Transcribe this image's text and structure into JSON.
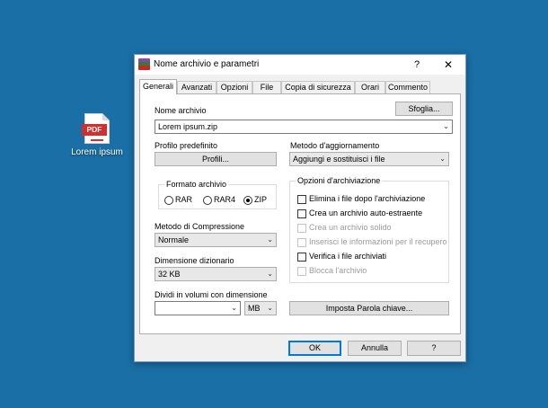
{
  "desktop": {
    "icon_label": "Lorem ipsum",
    "icon_badge": "PDF"
  },
  "dialog": {
    "title": "Nome archivio e parametri",
    "help_glyph": "?",
    "close_glyph": "✕",
    "tabs": [
      "Generali",
      "Avanzati",
      "Opzioni",
      "File",
      "Copia di sicurezza",
      "Orari",
      "Commento"
    ],
    "active_tab": "Generali",
    "archive_name_label": "Nome archivio",
    "browse_button": "Sfoglia...",
    "archive_name_value": "Lorem ipsum.zip",
    "default_profile_label": "Profilo predefinito",
    "profiles_button": "Profili...",
    "update_method_label": "Metodo d'aggiornamento",
    "update_method_value": "Aggiungi e sostituisci i file",
    "archive_format_label": "Formato archivio",
    "formats": [
      "RAR",
      "RAR4",
      "ZIP"
    ],
    "selected_format": "ZIP",
    "compression_label": "Metodo di Compressione",
    "compression_value": "Normale",
    "dictionary_label": "Dimensione dizionario",
    "dictionary_value": "32 KB",
    "split_label": "Dividi in volumi con dimensione",
    "split_value": "",
    "split_unit": "MB",
    "set_password_button": "Imposta Parola chiave...",
    "archiving_options_label": "Opzioni d'archiviazione",
    "options": [
      {
        "label": "Elimina i file dopo l'archiviazione",
        "checked": false,
        "enabled": true
      },
      {
        "label": "Crea un archivio auto-estraente",
        "checked": false,
        "enabled": true
      },
      {
        "label": "Crea un archivio solido",
        "checked": false,
        "enabled": false
      },
      {
        "label": "Inserisci le informazioni per il recupero",
        "checked": false,
        "enabled": false
      },
      {
        "label": "Verifica i file archiviati",
        "checked": false,
        "enabled": true
      },
      {
        "label": "Blocca l'archivio",
        "checked": false,
        "enabled": false
      }
    ],
    "ok_button": "OK",
    "cancel_button": "Annulla",
    "help_button": "?"
  },
  "colors": {
    "desktop": "#1a6fa6",
    "dialog_bg": "#f0f0f0",
    "accent": "#0078d7",
    "pdf_red": "#d32f2f"
  }
}
